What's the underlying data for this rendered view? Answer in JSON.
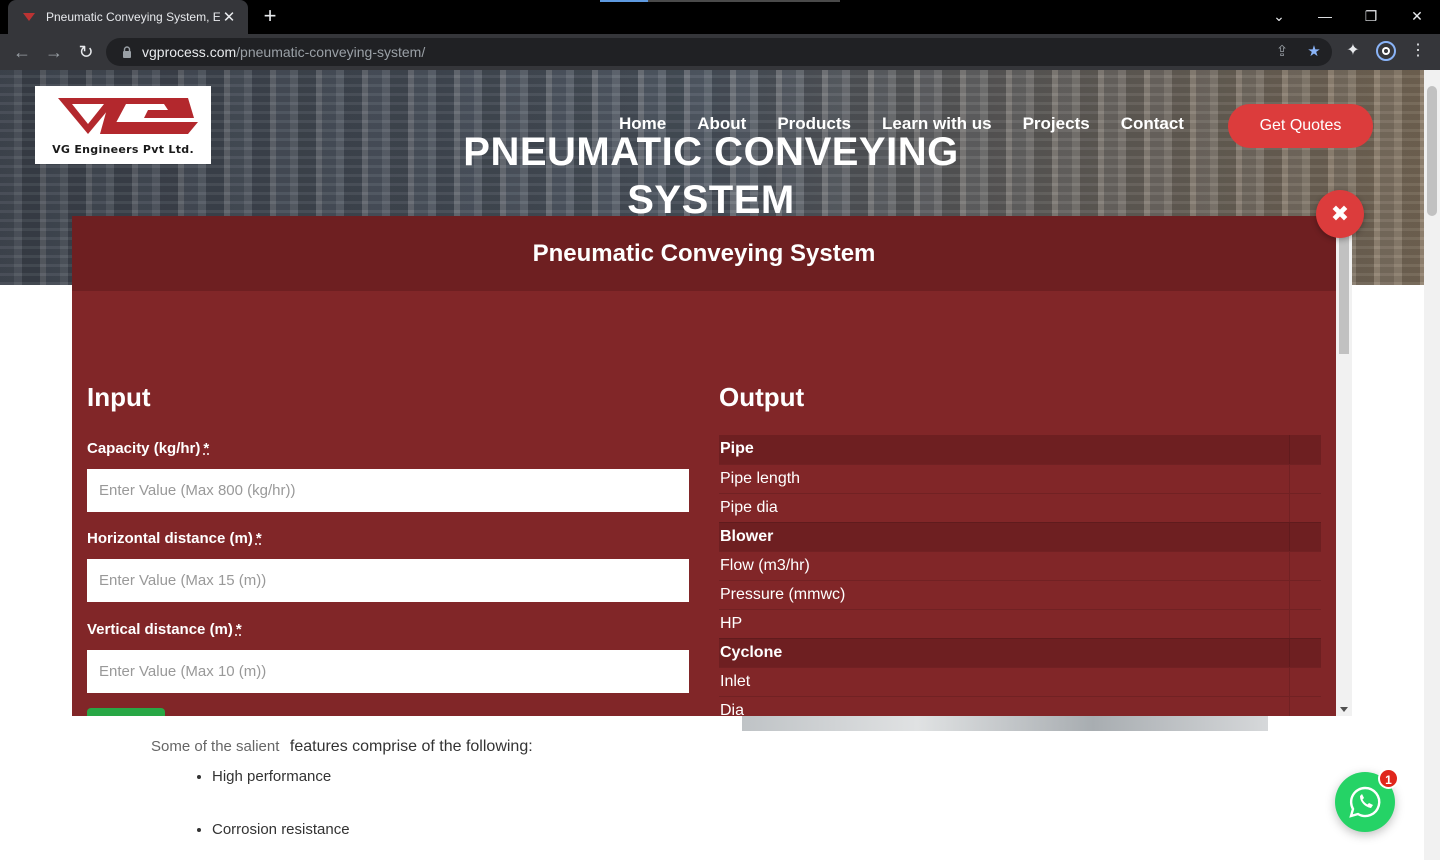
{
  "browser": {
    "tab_title": "Pneumatic Conveying System, Eq",
    "url_domain": "vgprocess.com",
    "url_path": "/pneumatic-conveying-system/"
  },
  "site": {
    "logo_text": "VG Engineers Pvt Ltd.",
    "nav": [
      "Home",
      "About",
      "Products",
      "Learn with us",
      "Projects",
      "Contact"
    ],
    "quote_button": "Get Quotes",
    "hero_title": "PNEUMATIC CONVEYING SYSTEM"
  },
  "modal": {
    "title": "Pneumatic Conveying System",
    "input_heading": "Input",
    "output_heading": "Output",
    "fields": [
      {
        "label": "Capacity (kg/hr)",
        "required": "*",
        "placeholder": "Enter Value (Max 800 (kg/hr))"
      },
      {
        "label": "Horizontal distance (m)",
        "required": "*",
        "placeholder": "Enter Value (Max 15 (m))"
      },
      {
        "label": "Vertical distance (m)",
        "required": "*",
        "placeholder": "Enter Value (Max 10 (m))"
      }
    ],
    "output_rows": [
      {
        "label": "Pipe",
        "group": true
      },
      {
        "label": "Pipe length",
        "group": false
      },
      {
        "label": "Pipe dia",
        "group": false
      },
      {
        "label": "Blower",
        "group": true
      },
      {
        "label": "Flow (m3/hr)",
        "group": false
      },
      {
        "label": "Pressure (mmwc)",
        "group": false
      },
      {
        "label": "HP",
        "group": false
      },
      {
        "label": "Cyclone",
        "group": true
      },
      {
        "label": "Inlet",
        "group": false
      },
      {
        "label": "Dia",
        "group": false
      }
    ]
  },
  "content": {
    "intro_muted": "Some of the salient",
    "intro_rest": "features comprise of the following:",
    "features": [
      "High performance",
      "Corrosion resistance"
    ]
  },
  "whatsapp_badge": "1",
  "colors": {
    "modal_bg": "#812628",
    "modal_header": "#6e1f21",
    "accent_red": "#dc3c3c",
    "whatsapp_green": "#25d366"
  }
}
